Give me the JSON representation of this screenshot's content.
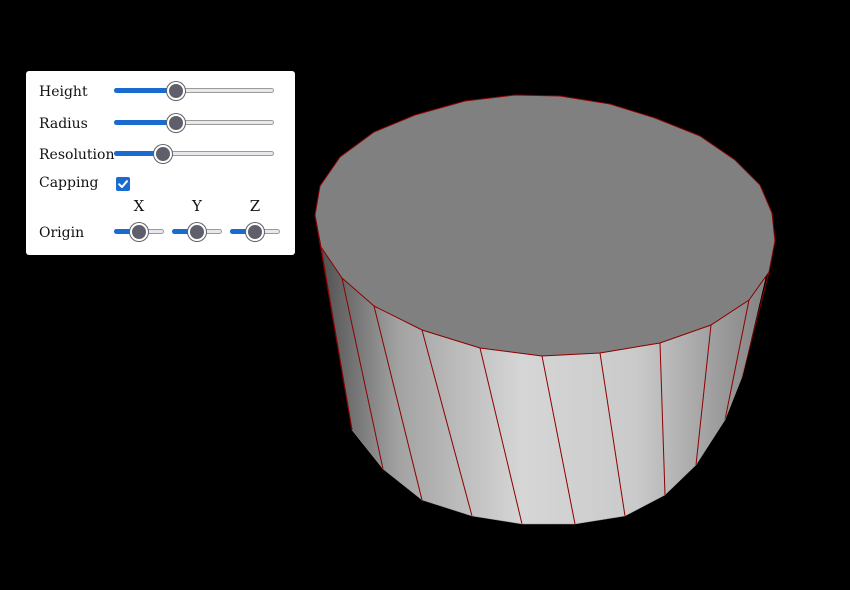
{
  "controls": {
    "height": {
      "label": "Height",
      "value": 0.37
    },
    "radius": {
      "label": "Radius",
      "value": 0.37
    },
    "resolution": {
      "label": "Resolution",
      "value": 0.28
    },
    "capping": {
      "label": "Capping",
      "checked": true
    },
    "origin": {
      "label": "Origin",
      "x": {
        "label": "X",
        "value": 0.5
      },
      "y": {
        "label": "Y",
        "value": 0.5
      },
      "z": {
        "label": "Z",
        "value": 0.5
      }
    }
  },
  "colors": {
    "background": "#000000",
    "panel": "#ffffff",
    "accent": "#1a6bd0",
    "cylinder_top": "#808080",
    "cylinder_edges": "#8b0000"
  }
}
